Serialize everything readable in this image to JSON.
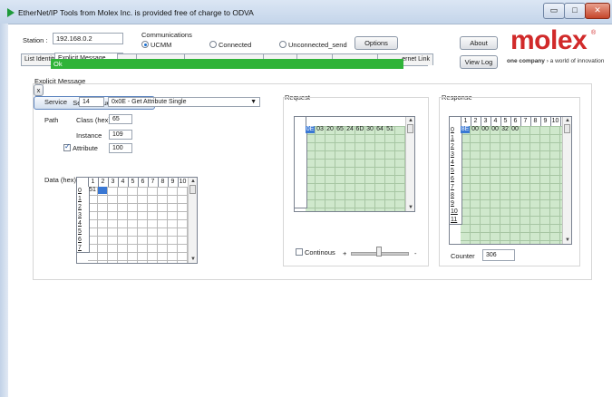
{
  "window": {
    "title": "EtherNet/IP Tools from Molex Inc. is provided free of charge to ODVA",
    "minimize_glyph": "▭",
    "maximize_glyph": "□",
    "close_glyph": "✕"
  },
  "station": {
    "label": "Station :",
    "value": "192.168.0.2"
  },
  "communications": {
    "label": "Communications",
    "options": [
      {
        "label": "UCMM",
        "selected": true
      },
      {
        "label": "Connected",
        "selected": false
      },
      {
        "label": "Unconnected_send",
        "selected": false
      }
    ],
    "options_button": "Options"
  },
  "header_buttons": {
    "about": "About",
    "view_log": "View Log"
  },
  "brand": {
    "logo": "molex",
    "registered": "®",
    "tagline_bold": "one company",
    "tagline_rest": " › a world of innovation",
    "color": "#d12a2a"
  },
  "tabs": [
    {
      "label": "List Identity"
    },
    {
      "label": "Explicit Message"
    },
    {
      "label": ""
    },
    {
      "label": ""
    },
    {
      "label": ""
    },
    {
      "label": ""
    },
    {
      "label": ""
    },
    {
      "label": ""
    },
    {
      "label": "ernet Link"
    }
  ],
  "status_bar": {
    "text": "Ok",
    "color": "#2fb338"
  },
  "explicit": {
    "section_label": "Explicit Message",
    "service": {
      "label": "Service",
      "code": "14",
      "name": "0x0E - Get Attribute Single"
    },
    "path": {
      "label": "Path",
      "class_label": "Class (hex)",
      "class_value": "65",
      "instance_label": "Instance",
      "instance_value": "109",
      "attribute_label": "Attribute",
      "attribute_checked": true,
      "attribute_value": "100"
    },
    "data": {
      "label": "Data (hex)",
      "columns": [
        "1",
        "2",
        "3",
        "4",
        "5",
        "6",
        "7",
        "8",
        "9",
        "10"
      ],
      "rows": [
        "0",
        "1",
        "2",
        "3",
        "4",
        "5",
        "6",
        "7"
      ],
      "row0_value": "51",
      "clear_button": "x"
    }
  },
  "request": {
    "label": "Request",
    "bytes": [
      "0E",
      "03",
      "20",
      "65",
      "24",
      "6D",
      "30",
      "64",
      "51"
    ],
    "send_button": "Send Request",
    "continous_label": "Continous",
    "plus": "+",
    "minus": "-"
  },
  "response": {
    "label": "Response",
    "columns": [
      "1",
      "2",
      "3",
      "4",
      "5",
      "6",
      "7",
      "8",
      "9",
      "10"
    ],
    "rows": [
      "0",
      "1",
      "2",
      "3",
      "4",
      "5",
      "6",
      "7",
      "8",
      "9",
      "10",
      "11"
    ],
    "bytes": [
      "8E",
      "00",
      "00",
      "00",
      "32",
      "00"
    ],
    "counter_label": "Counter",
    "counter_value": "306"
  }
}
